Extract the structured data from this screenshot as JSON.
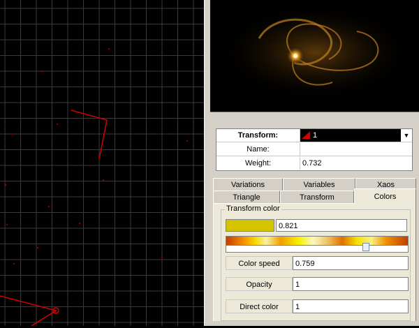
{
  "property_grid": {
    "transform_label": "Transform:",
    "transform_value": "1",
    "name_label": "Name:",
    "name_value": "",
    "weight_label": "Weight:",
    "weight_value": "0.732"
  },
  "tabs": {
    "row1": [
      "Variations",
      "Variables",
      "Xaos"
    ],
    "row2": [
      "Triangle",
      "Transform",
      "Colors"
    ],
    "active": "Colors"
  },
  "colors_tab": {
    "group_title": "Transform color",
    "swatch_color": "#d4c400",
    "color_value": "0.821",
    "gradient_position": 0.78,
    "color_speed_label": "Color speed",
    "color_speed_value": "0.759",
    "opacity_label": "Opacity",
    "opacity_value": "1",
    "direct_color_label": "Direct color",
    "direct_color_value": "1"
  },
  "icons": {
    "triangle": "red-triangle-icon",
    "dropdown": "chevron-down-icon"
  },
  "palette": {
    "grid_line": "#3a3a3a",
    "triangle_red": "#d40000",
    "panel_bg": "#d4d0c8",
    "page_bg": "#ece9d8"
  }
}
